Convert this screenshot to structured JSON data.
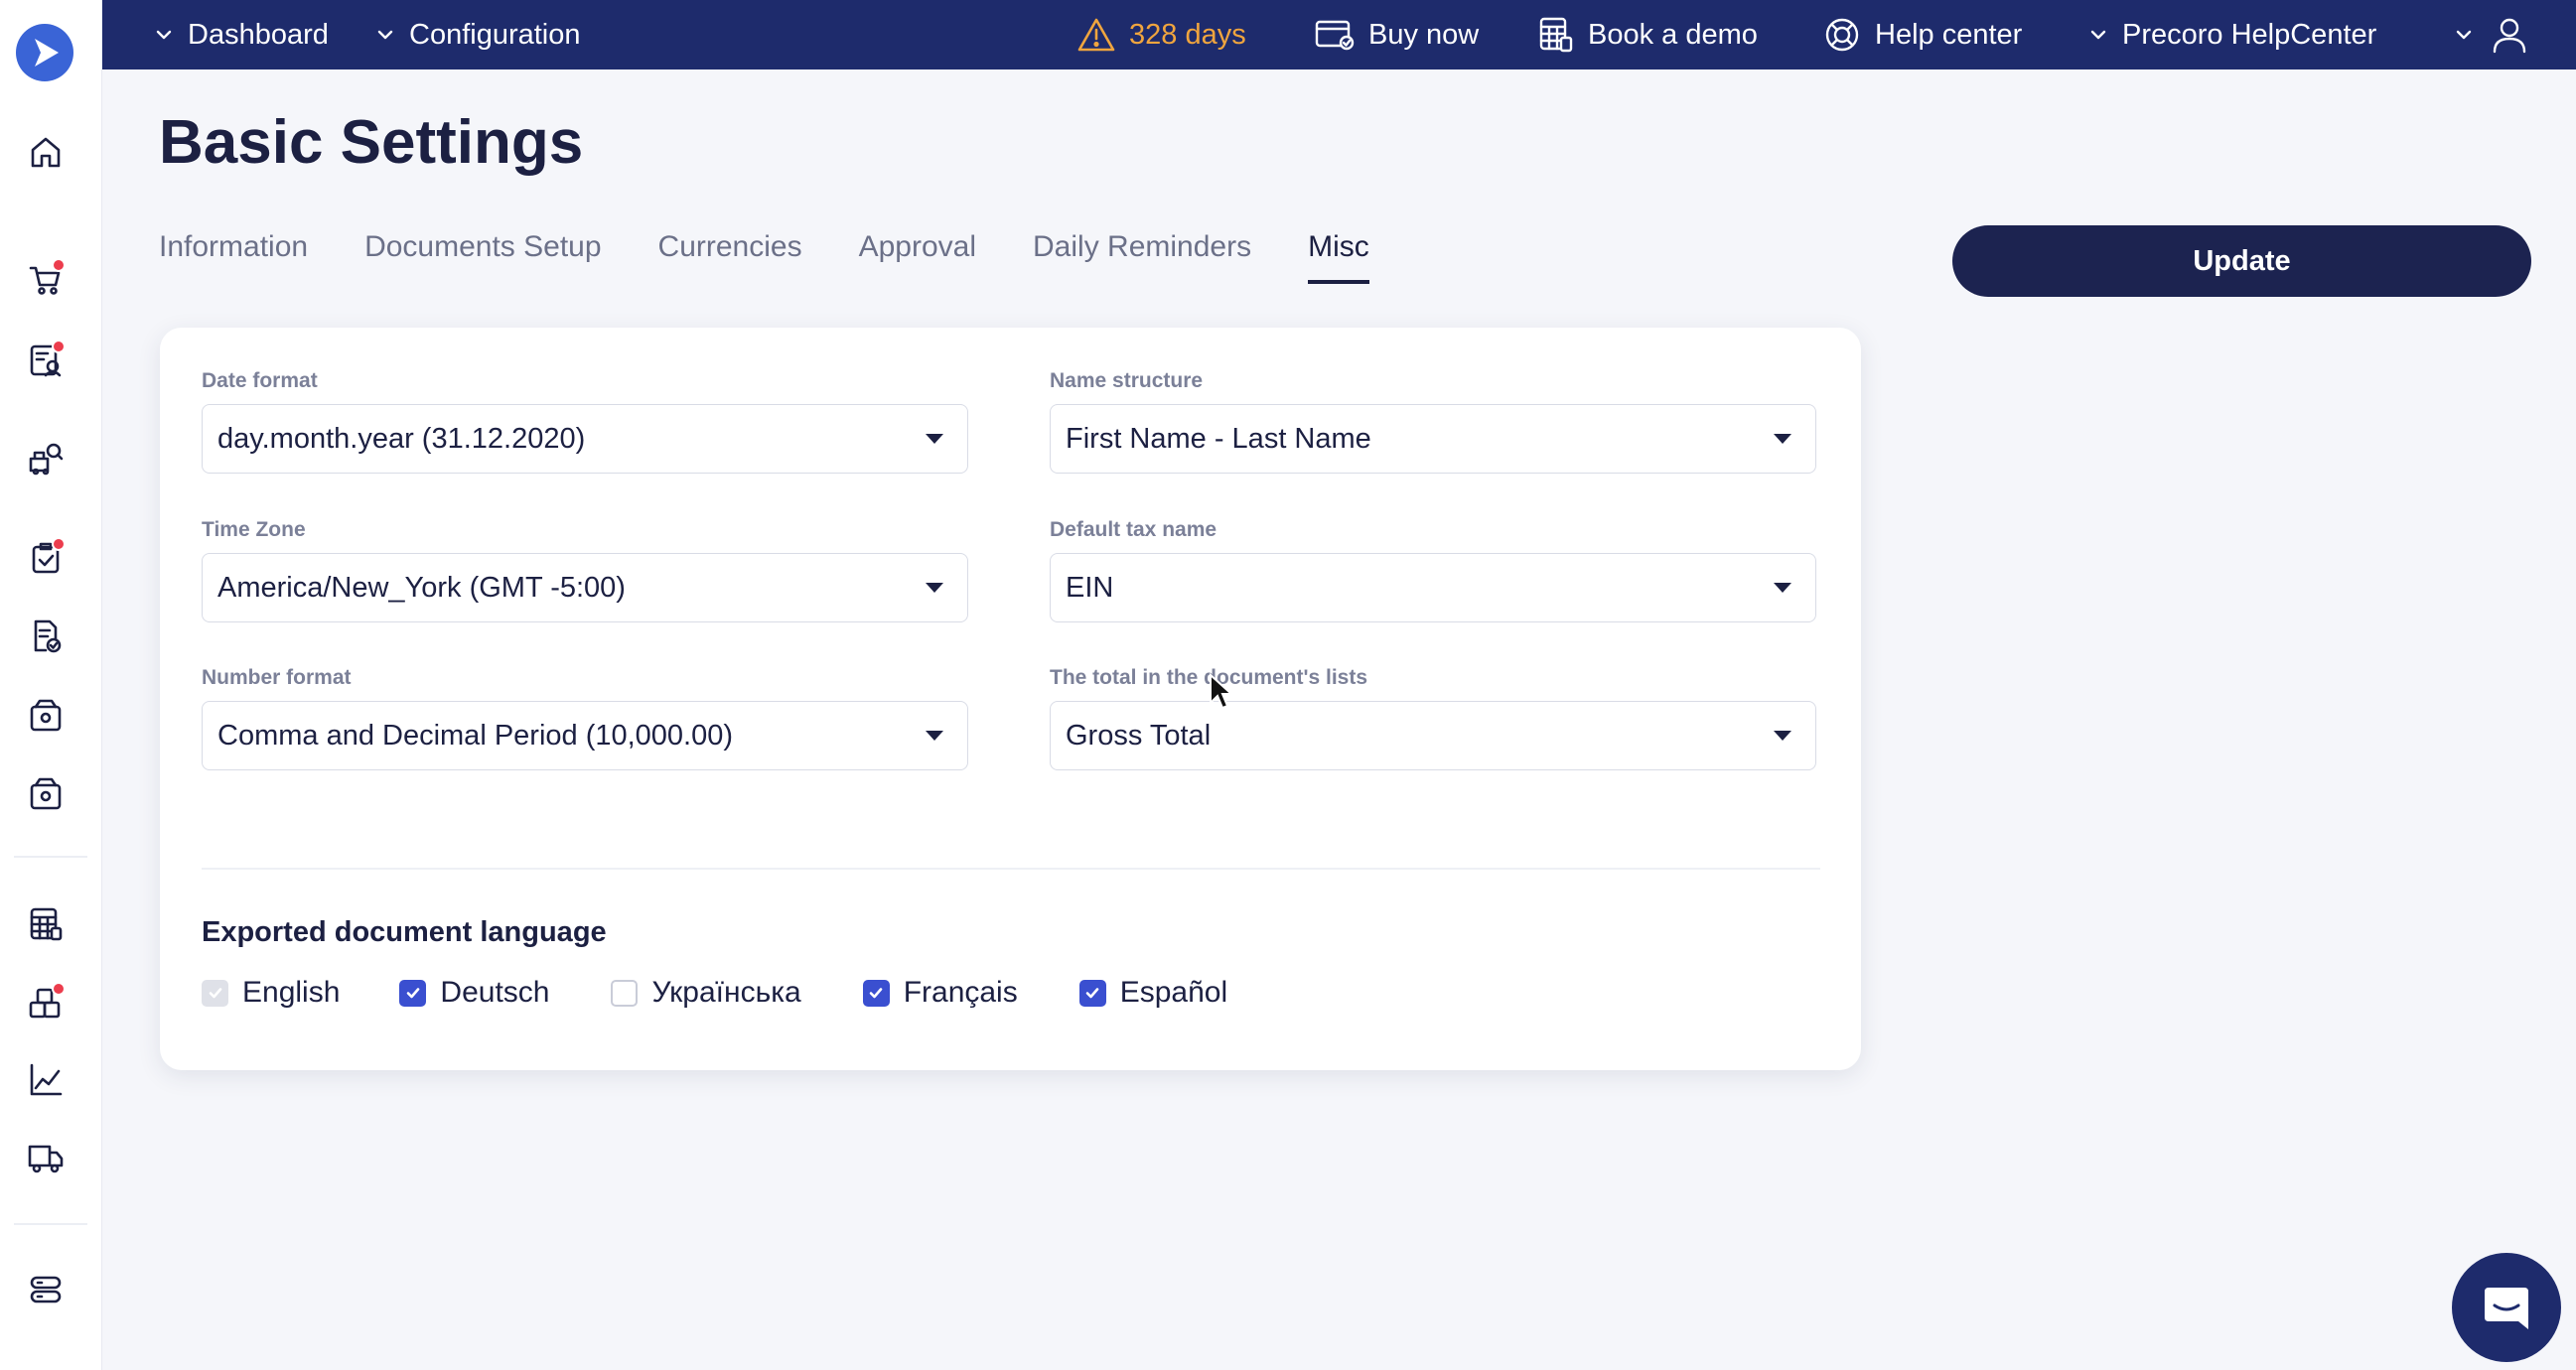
{
  "colors": {
    "topbar": "#1e2b6c",
    "accent": "#3a4fd0",
    "warning": "#f0a53e",
    "primary_button": "#1c2350",
    "notification_dot": "#ec3d4d"
  },
  "sidebar": {
    "logo": "precoro-play-logo",
    "items": [
      {
        "icon": "home-icon",
        "badge": false
      },
      {
        "icon": "shopping-cart-icon",
        "badge": true
      },
      {
        "icon": "approval-list-icon",
        "badge": true
      },
      {
        "icon": "supplier-search-icon",
        "badge": false
      },
      {
        "icon": "clipboard-check-icon",
        "badge": true
      },
      {
        "icon": "document-check-icon",
        "badge": false
      },
      {
        "icon": "wallet-icon",
        "badge": false
      },
      {
        "icon": "wallet-alt-icon",
        "badge": false
      },
      {
        "icon": "spreadsheet-icon",
        "badge": false
      },
      {
        "icon": "inventory-boxes-icon",
        "badge": true
      },
      {
        "icon": "analytics-chart-icon",
        "badge": false
      },
      {
        "icon": "delivery-truck-icon",
        "badge": false
      },
      {
        "icon": "server-settings-icon",
        "badge": false
      }
    ]
  },
  "topbar": {
    "dashboard": "Dashboard",
    "configuration": "Configuration",
    "trial_days": "328 days",
    "buy_now": "Buy now",
    "book_demo": "Book a demo",
    "help_center": "Help center",
    "company": "Precoro HelpCenter"
  },
  "page": {
    "title": "Basic Settings",
    "update_button": "Update"
  },
  "tabs": [
    {
      "label": "Information",
      "active": false
    },
    {
      "label": "Documents Setup",
      "active": false
    },
    {
      "label": "Currencies",
      "active": false
    },
    {
      "label": "Approval",
      "active": false
    },
    {
      "label": "Daily Reminders",
      "active": false
    },
    {
      "label": "Misc",
      "active": true
    }
  ],
  "settings": {
    "date_format": {
      "label": "Date format",
      "value": "day.month.year (31.12.2020)"
    },
    "name_structure": {
      "label": "Name structure",
      "value": "First Name - Last Name"
    },
    "time_zone": {
      "label": "Time Zone",
      "value": "America/New_York (GMT -5:00)"
    },
    "default_tax_name": {
      "label": "Default tax name",
      "value": "EIN"
    },
    "number_format": {
      "label": "Number format",
      "value": "Comma and Decimal Period (10,000.00)"
    },
    "total_in_lists": {
      "label": "The total in the document's lists",
      "value": "Gross Total"
    }
  },
  "export_language": {
    "title": "Exported document language",
    "options": [
      {
        "label": "English",
        "checked": true,
        "disabled": true
      },
      {
        "label": "Deutsch",
        "checked": true,
        "disabled": false
      },
      {
        "label": "Українська",
        "checked": false,
        "disabled": false
      },
      {
        "label": "Français",
        "checked": true,
        "disabled": false
      },
      {
        "label": "Español",
        "checked": true,
        "disabled": false
      }
    ]
  }
}
